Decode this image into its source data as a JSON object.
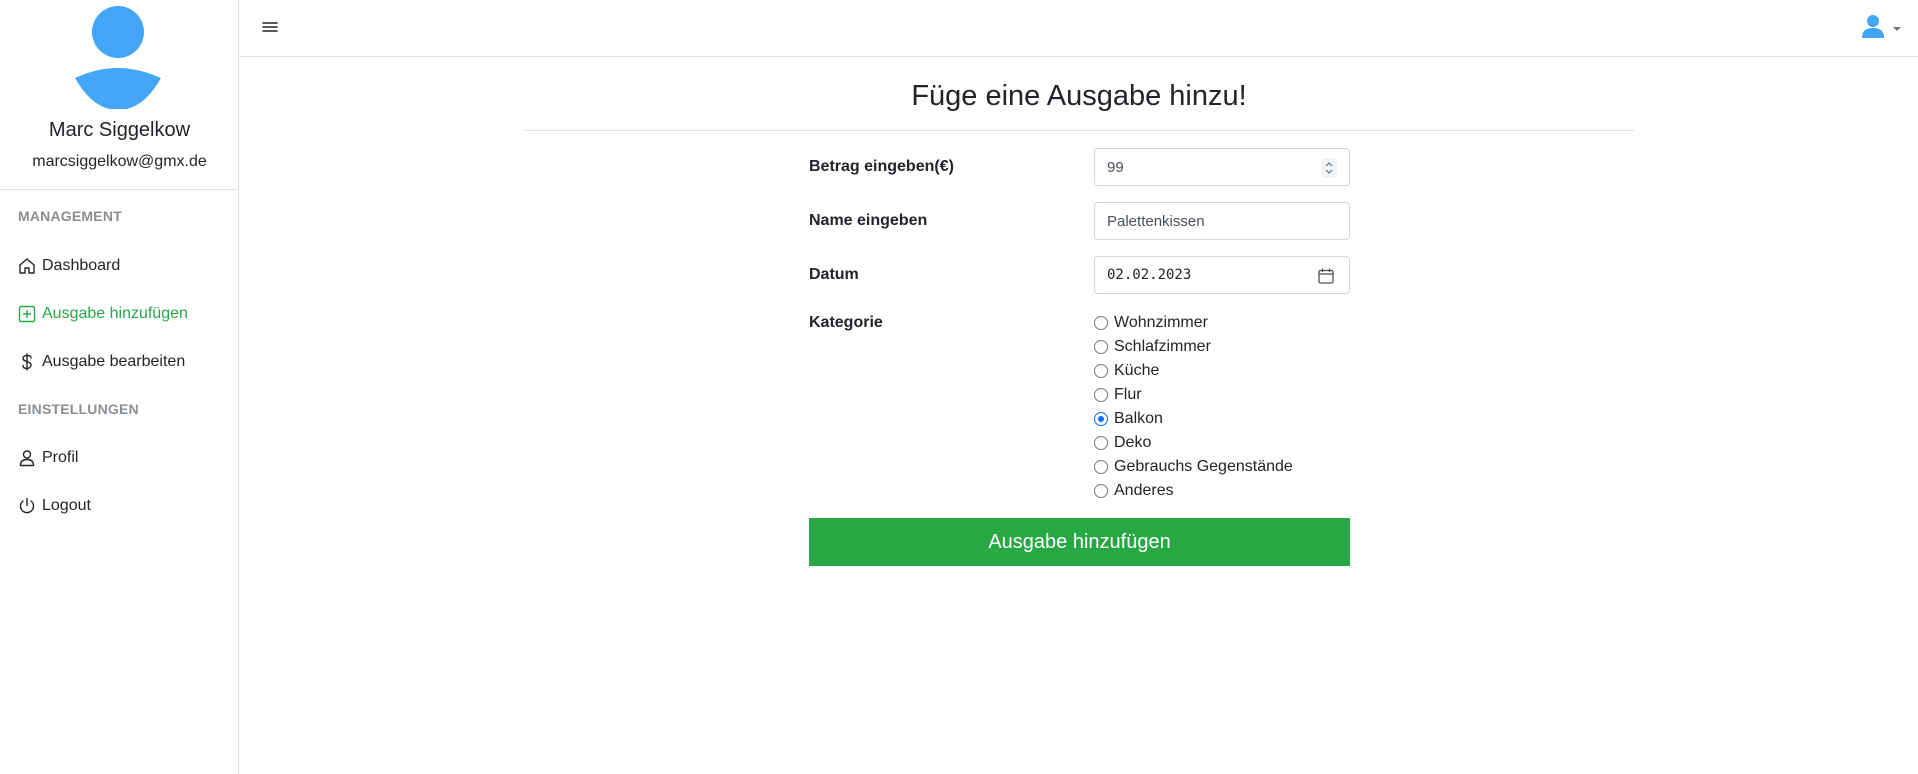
{
  "user": {
    "name": "Marc Siggelkow",
    "email": "marcsiggelkow@gmx.de"
  },
  "sidebar": {
    "sections": [
      {
        "heading": "MANAGEMENT",
        "items": [
          {
            "label": "Dashboard",
            "icon": "home-icon",
            "active": false
          },
          {
            "label": "Ausgabe hinzufügen",
            "icon": "plus-square-icon",
            "active": true
          },
          {
            "label": "Ausgabe bearbeiten",
            "icon": "dollar-icon",
            "active": false
          }
        ]
      },
      {
        "heading": "EINSTELLUNGEN",
        "items": [
          {
            "label": "Profil",
            "icon": "person-icon",
            "active": false
          },
          {
            "label": "Logout",
            "icon": "power-icon",
            "active": false
          }
        ]
      }
    ]
  },
  "topbar": {
    "menu_icon": "hamburger-icon",
    "user_icon": "user-avatar-icon"
  },
  "main": {
    "title": "Füge eine Ausgabe hinzu!",
    "form": {
      "amount": {
        "label": "Betrag eingeben(€)",
        "value": "99"
      },
      "name": {
        "label": "Name eingeben",
        "value": "Palettenkissen"
      },
      "date": {
        "label": "Datum",
        "value": "02.02.2023"
      },
      "category": {
        "label": "Kategorie",
        "options": [
          "Wohnzimmer",
          "Schlafzimmer",
          "Küche",
          "Flur",
          "Balkon",
          "Deko",
          "Gebrauchs Gegenstände",
          "Anderes"
        ],
        "selected": "Balkon"
      },
      "submit_label": "Ausgabe hinzufügen"
    }
  },
  "colors": {
    "accent": "#28a745",
    "avatar": "#42a5f5",
    "radio_checked": "#0d6efd"
  }
}
